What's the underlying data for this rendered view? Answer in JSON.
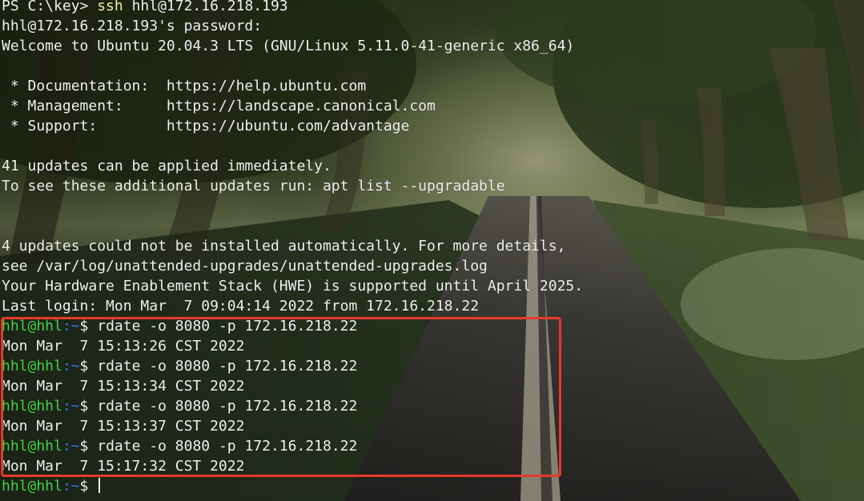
{
  "terminal": {
    "lines": [
      {
        "prefix": "PS C:\\key> ",
        "cmd": "ssh",
        "rest": " hhl@172.16.218.193"
      },
      {
        "text": "hhl@172.16.218.193's password:"
      },
      {
        "text": "Welcome to Ubuntu 20.04.3 LTS (GNU/Linux 5.11.0-41-generic x86_64)"
      },
      {
        "text": ""
      },
      {
        "text": " * Documentation:  https://help.ubuntu.com"
      },
      {
        "text": " * Management:     https://landscape.canonical.com"
      },
      {
        "text": " * Support:        https://ubuntu.com/advantage"
      },
      {
        "text": ""
      },
      {
        "text": "41 updates can be applied immediately."
      },
      {
        "text": "To see these additional updates run: apt list --upgradable"
      },
      {
        "text": ""
      },
      {
        "text": ""
      },
      {
        "text": "4 updates could not be installed automatically. For more details,"
      },
      {
        "text": "see /var/log/unattended-upgrades/unattended-upgrades.log"
      },
      {
        "text": "Your Hardware Enablement Stack (HWE) is supported until April 2025."
      },
      {
        "text": "Last login: Mon Mar  7 09:04:14 2022 from 172.16.218.22"
      }
    ],
    "prompt_user": "hhl@hhl",
    "prompt_path": ":~",
    "prompt_symbol": "$ ",
    "sessions": [
      {
        "command": "rdate -o 8080 -p 172.16.218.22",
        "output": "Mon Mar  7 15:13:26 CST 2022"
      },
      {
        "command": "rdate -o 8080 -p 172.16.218.22",
        "output": "Mon Mar  7 15:13:34 CST 2022"
      },
      {
        "command": "rdate -o 8080 -p 172.16.218.22",
        "output": "Mon Mar  7 15:13:37 CST 2022"
      },
      {
        "command": "rdate -o 8080 -p 172.16.218.22",
        "output": "Mon Mar  7 15:17:32 CST 2022"
      }
    ]
  },
  "colors": {
    "prompt_user": "#4bd14b",
    "prompt_path": "#3b78ff",
    "keyword": "#f9f1a5",
    "highlight_box": "#e53a2b"
  }
}
